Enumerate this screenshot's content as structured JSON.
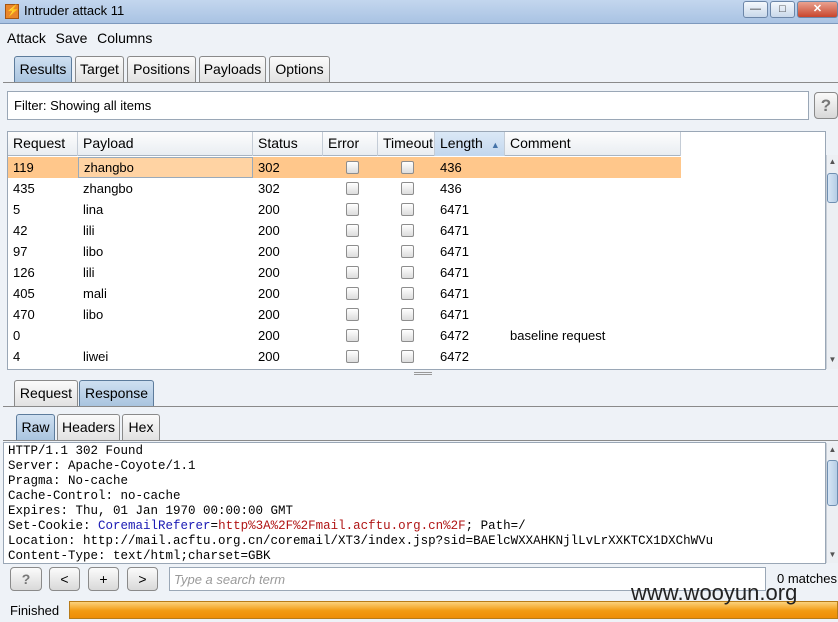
{
  "window": {
    "title": "Intruder attack 11"
  },
  "menu": [
    "Attack",
    "Save",
    "Columns"
  ],
  "main_tabs": [
    {
      "label": "Results",
      "active": true
    },
    {
      "label": "Target"
    },
    {
      "label": "Positions"
    },
    {
      "label": "Payloads"
    },
    {
      "label": "Options"
    }
  ],
  "filter": {
    "text": "Filter: Showing all items",
    "help_label": "?"
  },
  "table": {
    "columns": [
      "Request",
      "Payload",
      "Status",
      "Error",
      "Timeout",
      "Length",
      "Comment"
    ],
    "sorted_column": "Length",
    "rows": [
      {
        "request": "119",
        "payload": "zhangbo",
        "status": "302",
        "length": "436",
        "comment": "",
        "selected": true
      },
      {
        "request": "435",
        "payload": "zhangbo",
        "status": "302",
        "length": "436",
        "comment": ""
      },
      {
        "request": "5",
        "payload": "lina",
        "status": "200",
        "length": "6471",
        "comment": ""
      },
      {
        "request": "42",
        "payload": "lili",
        "status": "200",
        "length": "6471",
        "comment": ""
      },
      {
        "request": "97",
        "payload": "libo",
        "status": "200",
        "length": "6471",
        "comment": ""
      },
      {
        "request": "126",
        "payload": "lili",
        "status": "200",
        "length": "6471",
        "comment": ""
      },
      {
        "request": "405",
        "payload": "mali",
        "status": "200",
        "length": "6471",
        "comment": ""
      },
      {
        "request": "470",
        "payload": "libo",
        "status": "200",
        "length": "6471",
        "comment": ""
      },
      {
        "request": "0",
        "payload": "",
        "status": "200",
        "length": "6472",
        "comment": "baseline request"
      },
      {
        "request": "4",
        "payload": "liwei",
        "status": "200",
        "length": "6472",
        "comment": ""
      }
    ]
  },
  "detail_tabs": [
    {
      "label": "Request"
    },
    {
      "label": "Response",
      "active": true
    }
  ],
  "view_tabs": [
    {
      "label": "Raw",
      "active": true
    },
    {
      "label": "Headers"
    },
    {
      "label": "Hex"
    }
  ],
  "response_raw": [
    "HTTP/1.1 302 Found",
    "Server: Apache-Coyote/1.1",
    "Pragma: No-cache",
    "Cache-Control: no-cache",
    "Expires: Thu, 01 Jan 1970 00:00:00 GMT",
    {
      "prefix": "Set-Cookie: ",
      "name": "CoremailReferer",
      "eq": "=",
      "value": "http%3A%2F%2Fmail.acftu.org.cn%2F",
      "suffix": "; Path=/"
    },
    "Location: http://mail.acftu.org.cn/coremail/XT3/index.jsp?sid=BAElcWXXAHKNjlLvLrXXKTCX1DXChWVu",
    "Content-Type: text/html;charset=GBK"
  ],
  "search": {
    "help_label": "?",
    "prev_label": "<",
    "add_label": "+",
    "next_label": ">",
    "placeholder": "Type a search term",
    "value": "",
    "matches": "0 matches"
  },
  "status": {
    "text": "Finished",
    "progress": 1.0
  },
  "watermark": "www.wooyun.org",
  "colors": {
    "selected_row": "#ffc78b",
    "progress": "#f29a12",
    "cookie_name": "#1b1bb4",
    "cookie_value": "#b01515"
  }
}
